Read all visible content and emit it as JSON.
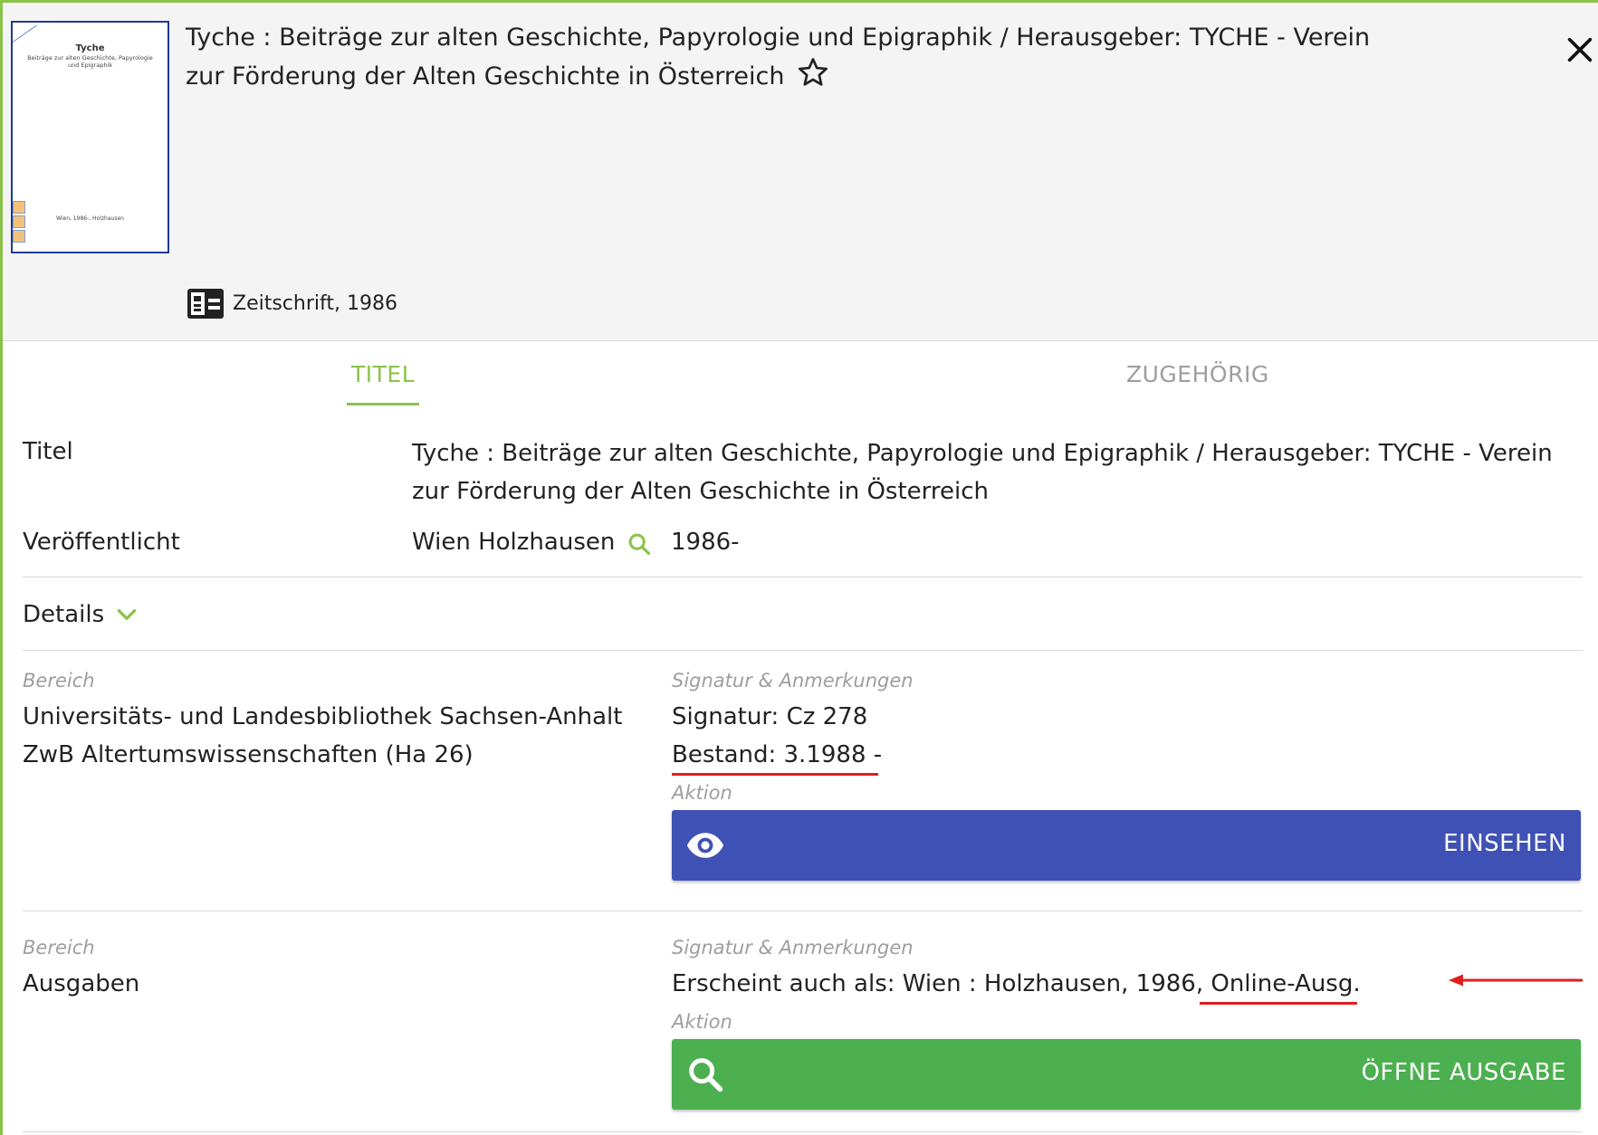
{
  "header": {
    "title": "Tyche : Beiträge zur alten Geschichte, Papyrologie und Epigraphik / Herausgeber: TYCHE - Verein zur Förderung der Alten Geschichte in Österreich",
    "cover": {
      "title": "Tyche",
      "subtitle": "Beiträge zur alten Geschichte, Papyrologie und Epigraphik",
      "imprint": "Wien, 1986-, Holzhausen"
    },
    "type_label": "Zeitschrift, 1986"
  },
  "tabs": [
    {
      "label": "TITEL",
      "active": true
    },
    {
      "label": "ZUGEHÖRIG",
      "active": false
    }
  ],
  "details": {
    "titel_label": "Titel",
    "titel_value": "Tyche : Beiträge zur alten Geschichte, Papyrologie und Epigraphik / Herausgeber: TYCHE - Verein zur Förderung der Alten Geschichte in Österreich",
    "veroeffentlicht_label": "Veröffentlicht",
    "veroeffentlicht_place": "Wien Holzhausen",
    "veroeffentlicht_year": "1986-",
    "details_toggle": "Details"
  },
  "holdings": [
    {
      "bereich_label": "Bereich",
      "bereich_line1": "Universitäts- und Landesbibliothek Sachsen-Anhalt",
      "bereich_line2": "ZwB Altertumswissenschaften (Ha 26)",
      "signatur_label": "Signatur & Anmerkungen",
      "signatur": "Signatur: Cz 278",
      "bestand": "Bestand: 3.1988 -",
      "aktion_label": "Aktion",
      "button": "EINSEHEN"
    },
    {
      "bereich_label": "Bereich",
      "bereich_line1": "Ausgaben",
      "signatur_label": "Signatur & Anmerkungen",
      "erscheint_prefix": "Erscheint auch als: Wien : Holzhausen, 1986, ",
      "erscheint_link": "Online-Ausg.",
      "aktion_label": "Aktion",
      "button": "ÖFFNE AUSGABE"
    }
  ],
  "colors": {
    "accent_green": "#8bc34a",
    "button_blue": "#3f51b5",
    "button_green": "#4caf50",
    "annotation_red": "#e01e1e"
  },
  "icons": [
    "star-icon",
    "close-icon",
    "journal-type-icon",
    "search-icon",
    "chevron-down-icon",
    "eye-icon",
    "arrow-left-icon"
  ]
}
